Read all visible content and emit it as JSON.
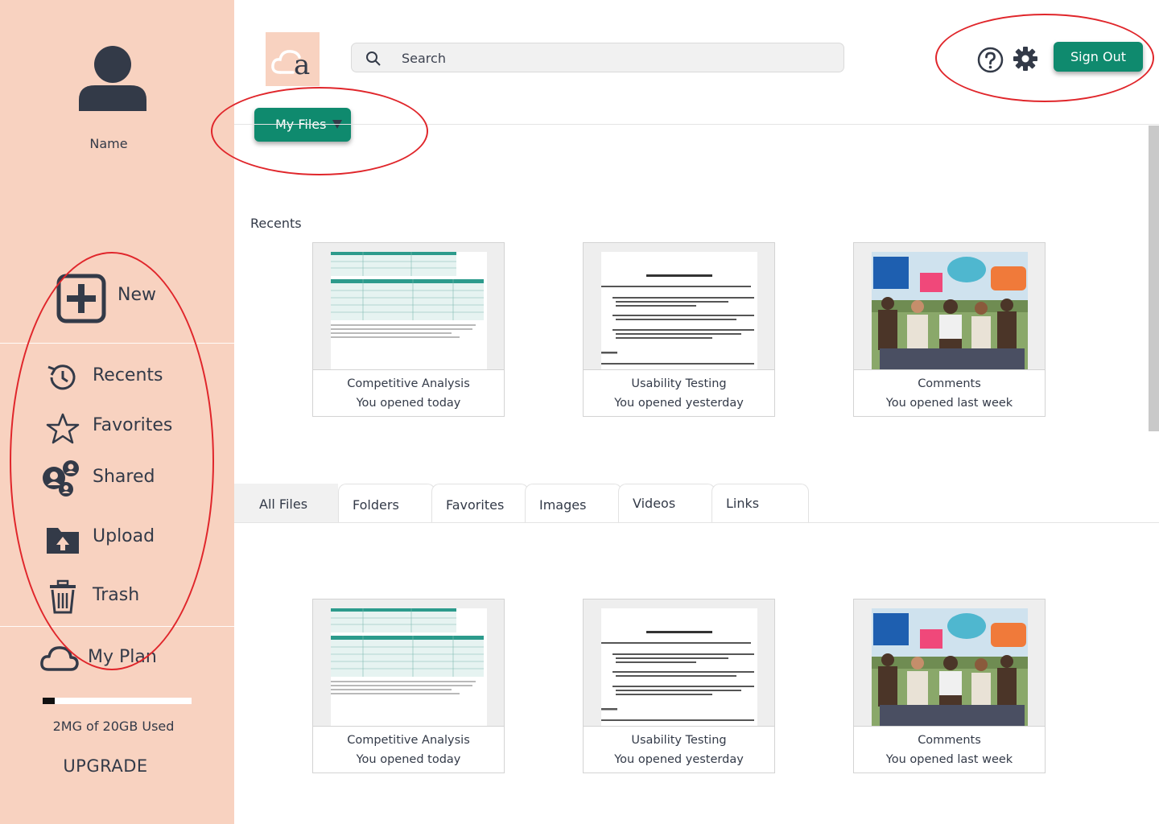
{
  "user": {
    "name": "Name"
  },
  "sidebar": {
    "new_label": "New",
    "items": [
      {
        "label": "Recents",
        "icon": "history-icon"
      },
      {
        "label": "Favorites",
        "icon": "star-icon"
      },
      {
        "label": "Shared",
        "icon": "shared-users-icon"
      },
      {
        "label": "Upload",
        "icon": "upload-folder-icon"
      },
      {
        "label": "Trash",
        "icon": "trash-icon"
      }
    ],
    "plan": {
      "label": "My Plan",
      "usage_text": "2MG of 20GB Used",
      "usage_fraction": 0.08,
      "upgrade_label": "UPGRADE"
    }
  },
  "header": {
    "logo_letter": "a",
    "search_placeholder": "Search",
    "signout_label": "Sign Out",
    "myfiles_label": "My Files"
  },
  "recents": {
    "title": "Recents",
    "cards": [
      {
        "title": "Competitive Analysis",
        "subtitle": "You opened today",
        "thumb": "spreadsheet"
      },
      {
        "title": "Usability Testing",
        "subtitle": "You opened yesterday",
        "thumb": "document"
      },
      {
        "title": "Comments",
        "subtitle": "You opened last week",
        "thumb": "photo"
      }
    ]
  },
  "tabs": [
    "All Files",
    "Folders",
    "Favorites",
    "Images",
    "Videos",
    "Links"
  ],
  "files": {
    "cards": [
      {
        "title": "Competitive Analysis",
        "subtitle": "You opened today",
        "thumb": "spreadsheet"
      },
      {
        "title": "Usability Testing",
        "subtitle": "You opened yesterday",
        "thumb": "document"
      },
      {
        "title": "Comments",
        "subtitle": "You opened last week",
        "thumb": "photo"
      }
    ]
  },
  "colors": {
    "sidebar_bg": "#f8d2c0",
    "accent_green": "#0f8a6e",
    "text_dark": "#333a48",
    "annotation_red": "#e0262b"
  }
}
